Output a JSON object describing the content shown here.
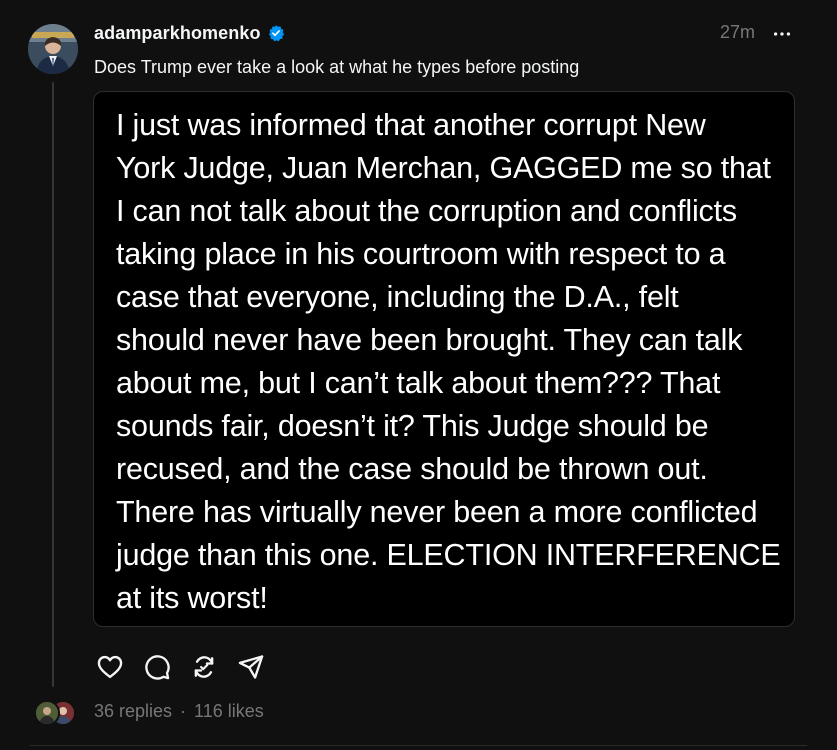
{
  "post": {
    "username": "adamparkhomenko",
    "verified": true,
    "timestamp": "27m",
    "caption": "Does Trump ever take a look at what he types before posting",
    "quote_text": "I just was informed that another corrupt New\nYork Judge, Juan Merchan, GAGGED me so that\nI can not talk about the corruption and conflicts\ntaking place in his courtroom with respect to a\ncase that everyone, including the D.A., felt\nshould never have been brought. They can talk\nabout me, but I can’t talk about them??? That\nsounds fair, doesn’t it? This Judge should be\nrecused, and the case should be thrown out.\nThere has virtually never been a more conflicted\njudge than this one. ELECTION INTERFERENCE\nat its worst!"
  },
  "actions": {
    "like_icon": "heart-icon",
    "reply_icon": "comment-icon",
    "repost_icon": "repost-icon",
    "share_icon": "send-icon"
  },
  "stats": {
    "replies": "36 replies",
    "separator": "·",
    "likes": "116 likes"
  },
  "colors": {
    "background": "#101010",
    "text_primary": "#f3f5f7",
    "text_secondary": "#777777",
    "verified": "#0095f6",
    "card_background": "#000000",
    "card_border": "#2e2e2e"
  }
}
